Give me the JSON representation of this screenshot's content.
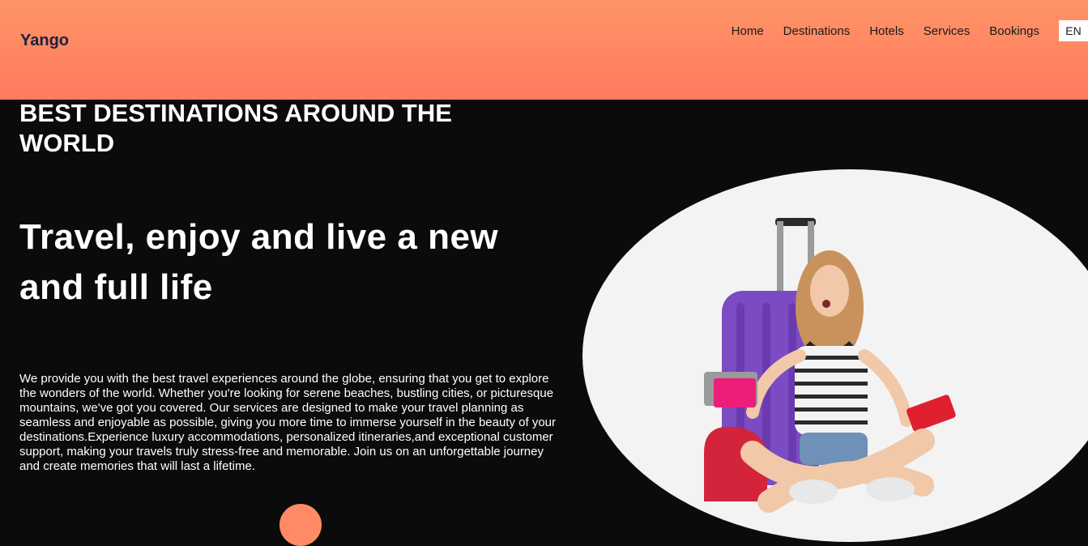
{
  "header": {
    "logo": "Yango",
    "nav": [
      "Home",
      "Destinations",
      "Hotels",
      "Services",
      "Bookings"
    ],
    "lang": "EN"
  },
  "hero": {
    "subtitle": "BEST DESTINATIONS AROUND THE WORLD",
    "headline": "Travel, enjoy and live a new and full life",
    "description": "We provide you with the best travel experiences around the globe, ensuring that you get to explore the wonders of the world. Whether you're looking for serene beaches, bustling cities, or picturesque mountains, we've got you covered. Our services are designed to make your travel planning as seamless and enjoyable as possible, giving you more time to immerse yourself in the beauty of your destinations.Experience luxury accommodations, personalized itineraries,and exceptional customer support, making your travels truly stress-free and memorable. Join us on an unforgettable journey and create memories that will last a lifetime."
  },
  "colors": {
    "header_top": "#ff9466",
    "header_bottom": "#ff7a5f",
    "background": "#0b0b0b",
    "accent": "#ff8a65"
  }
}
